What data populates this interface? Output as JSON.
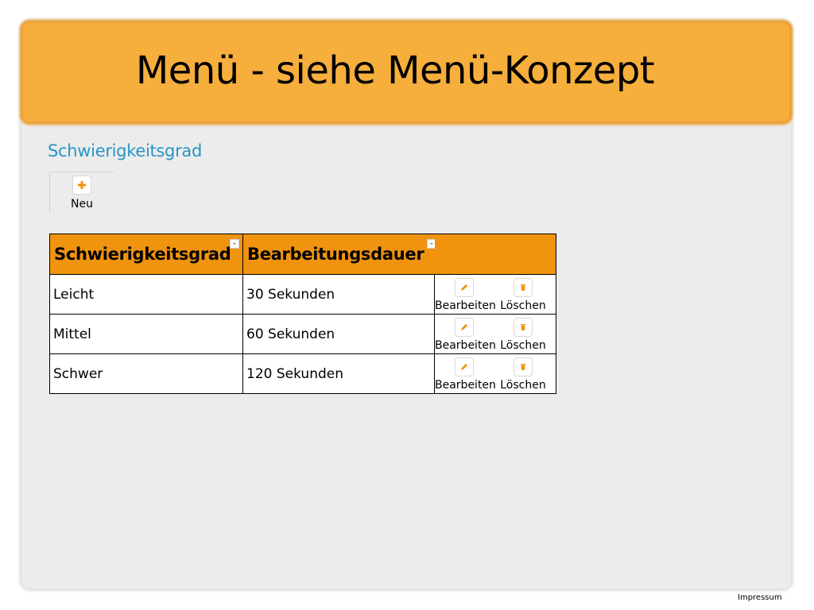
{
  "header": {
    "title": "Menü - siehe Menü-Konzept"
  },
  "page": {
    "heading": "Schwierigkeitsgrad"
  },
  "toolbar": {
    "new_label": "Neu"
  },
  "table": {
    "columns": [
      "Schwierigkeitsgrad",
      "Bearbeitungsdauer"
    ],
    "edit_label": "Bearbeiten",
    "delete_label": "Löschen",
    "rows": [
      {
        "level": "Leicht",
        "duration": "30 Sekunden"
      },
      {
        "level": "Mittel",
        "duration": "60 Sekunden"
      },
      {
        "level": "Schwer",
        "duration": "120 Sekunden"
      }
    ]
  },
  "footer": {
    "impressum": "Impressum"
  },
  "colors": {
    "header_bg": "#f6ae3c",
    "table_header_bg": "#f0930e",
    "heading_text": "#2795c4",
    "icon_orange": "#f0930e"
  },
  "icons": {
    "new": "plus-icon",
    "edit": "pencil-icon",
    "delete": "trash-icon",
    "sort": "sort-dropdown-icon"
  }
}
